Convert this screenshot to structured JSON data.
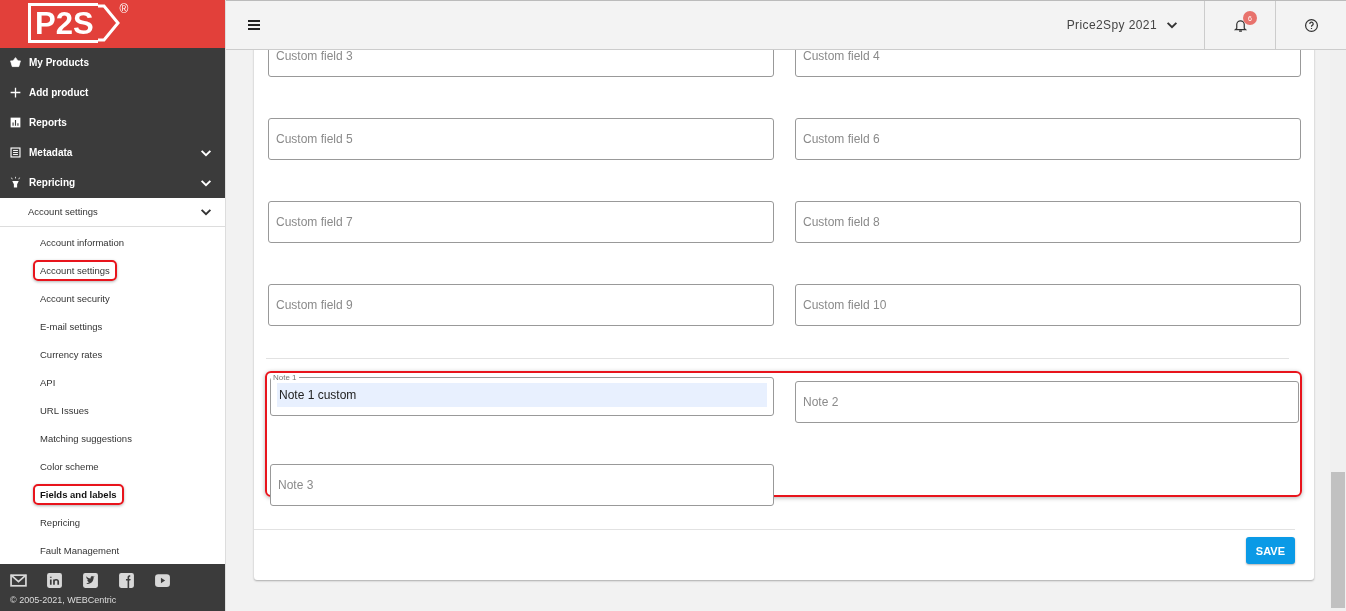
{
  "sidebar": {
    "logo": "P2S",
    "logo_mark": "®",
    "items": [
      {
        "label": "My Products",
        "expandable": false
      },
      {
        "label": "Add product",
        "expandable": false
      },
      {
        "label": "Reports",
        "expandable": false
      },
      {
        "label": "Metadata",
        "expandable": true
      },
      {
        "label": "Repricing",
        "expandable": true
      }
    ],
    "group": {
      "label": "Account settings",
      "expanded": true
    },
    "subitems": [
      {
        "label": "Account information",
        "selected": false,
        "highlighted": false
      },
      {
        "label": "Account settings",
        "selected": false,
        "highlighted": true
      },
      {
        "label": "Account security",
        "selected": false,
        "highlighted": false
      },
      {
        "label": "E-mail settings",
        "selected": false,
        "highlighted": false
      },
      {
        "label": "Currency rates",
        "selected": false,
        "highlighted": false
      },
      {
        "label": "API",
        "selected": false,
        "highlighted": false
      },
      {
        "label": "URL Issues",
        "selected": false,
        "highlighted": false
      },
      {
        "label": "Matching suggestions",
        "selected": false,
        "highlighted": false
      },
      {
        "label": "Color scheme",
        "selected": false,
        "highlighted": false
      },
      {
        "label": "Fields and labels",
        "selected": true,
        "highlighted": true
      },
      {
        "label": "Repricing",
        "selected": false,
        "highlighted": false
      },
      {
        "label": "Fault Management",
        "selected": false,
        "highlighted": false
      }
    ],
    "copyright": "© 2005-2021, WEBCentric"
  },
  "topbar": {
    "account": "Price2Spy 2021",
    "notifications": "6"
  },
  "custom_fields": [
    {
      "placeholder": "Custom field 3"
    },
    {
      "placeholder": "Custom field 4"
    },
    {
      "placeholder": "Custom field 5"
    },
    {
      "placeholder": "Custom field 6"
    },
    {
      "placeholder": "Custom field 7"
    },
    {
      "placeholder": "Custom field 8"
    },
    {
      "placeholder": "Custom field 9"
    },
    {
      "placeholder": "Custom field 10"
    }
  ],
  "notes": {
    "highlighted": true,
    "fields": [
      {
        "label": "Note 1",
        "value": "Note 1 custom",
        "autofilled": true
      },
      {
        "placeholder": "Note 2"
      },
      {
        "placeholder": "Note 3"
      }
    ]
  },
  "save_button": "SAVE"
}
